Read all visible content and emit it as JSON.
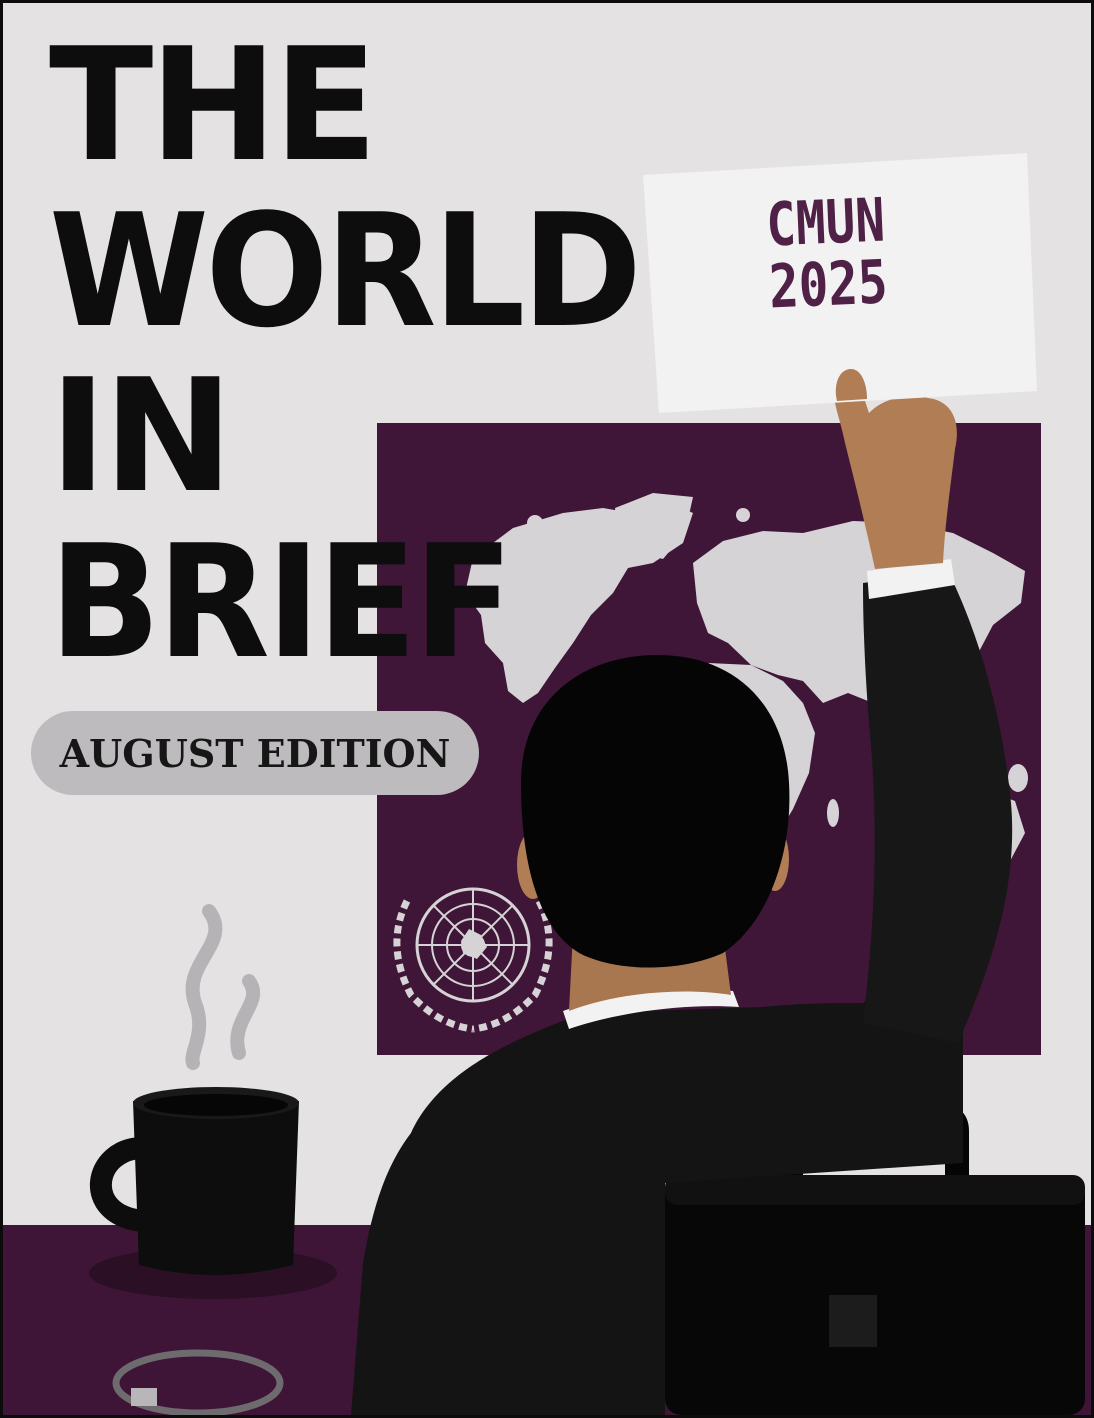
{
  "cover": {
    "title_lines": [
      "THE",
      "WORLD",
      "IN",
      "BRIEF"
    ],
    "edition": "AUGUST EDITION",
    "placard_lines": [
      "CMUN",
      "2025"
    ]
  },
  "colors": {
    "background": "#e4e2e3",
    "plum": "#3f1637",
    "title": "#0d0d0d",
    "placard_text": "#4f2147",
    "map_land": "#d6d3d6",
    "suit": "#141414",
    "skin": "#b07d55"
  },
  "icons": [
    "world-map-icon",
    "un-emblem-icon",
    "coffee-mug-icon",
    "briefcase-icon"
  ]
}
